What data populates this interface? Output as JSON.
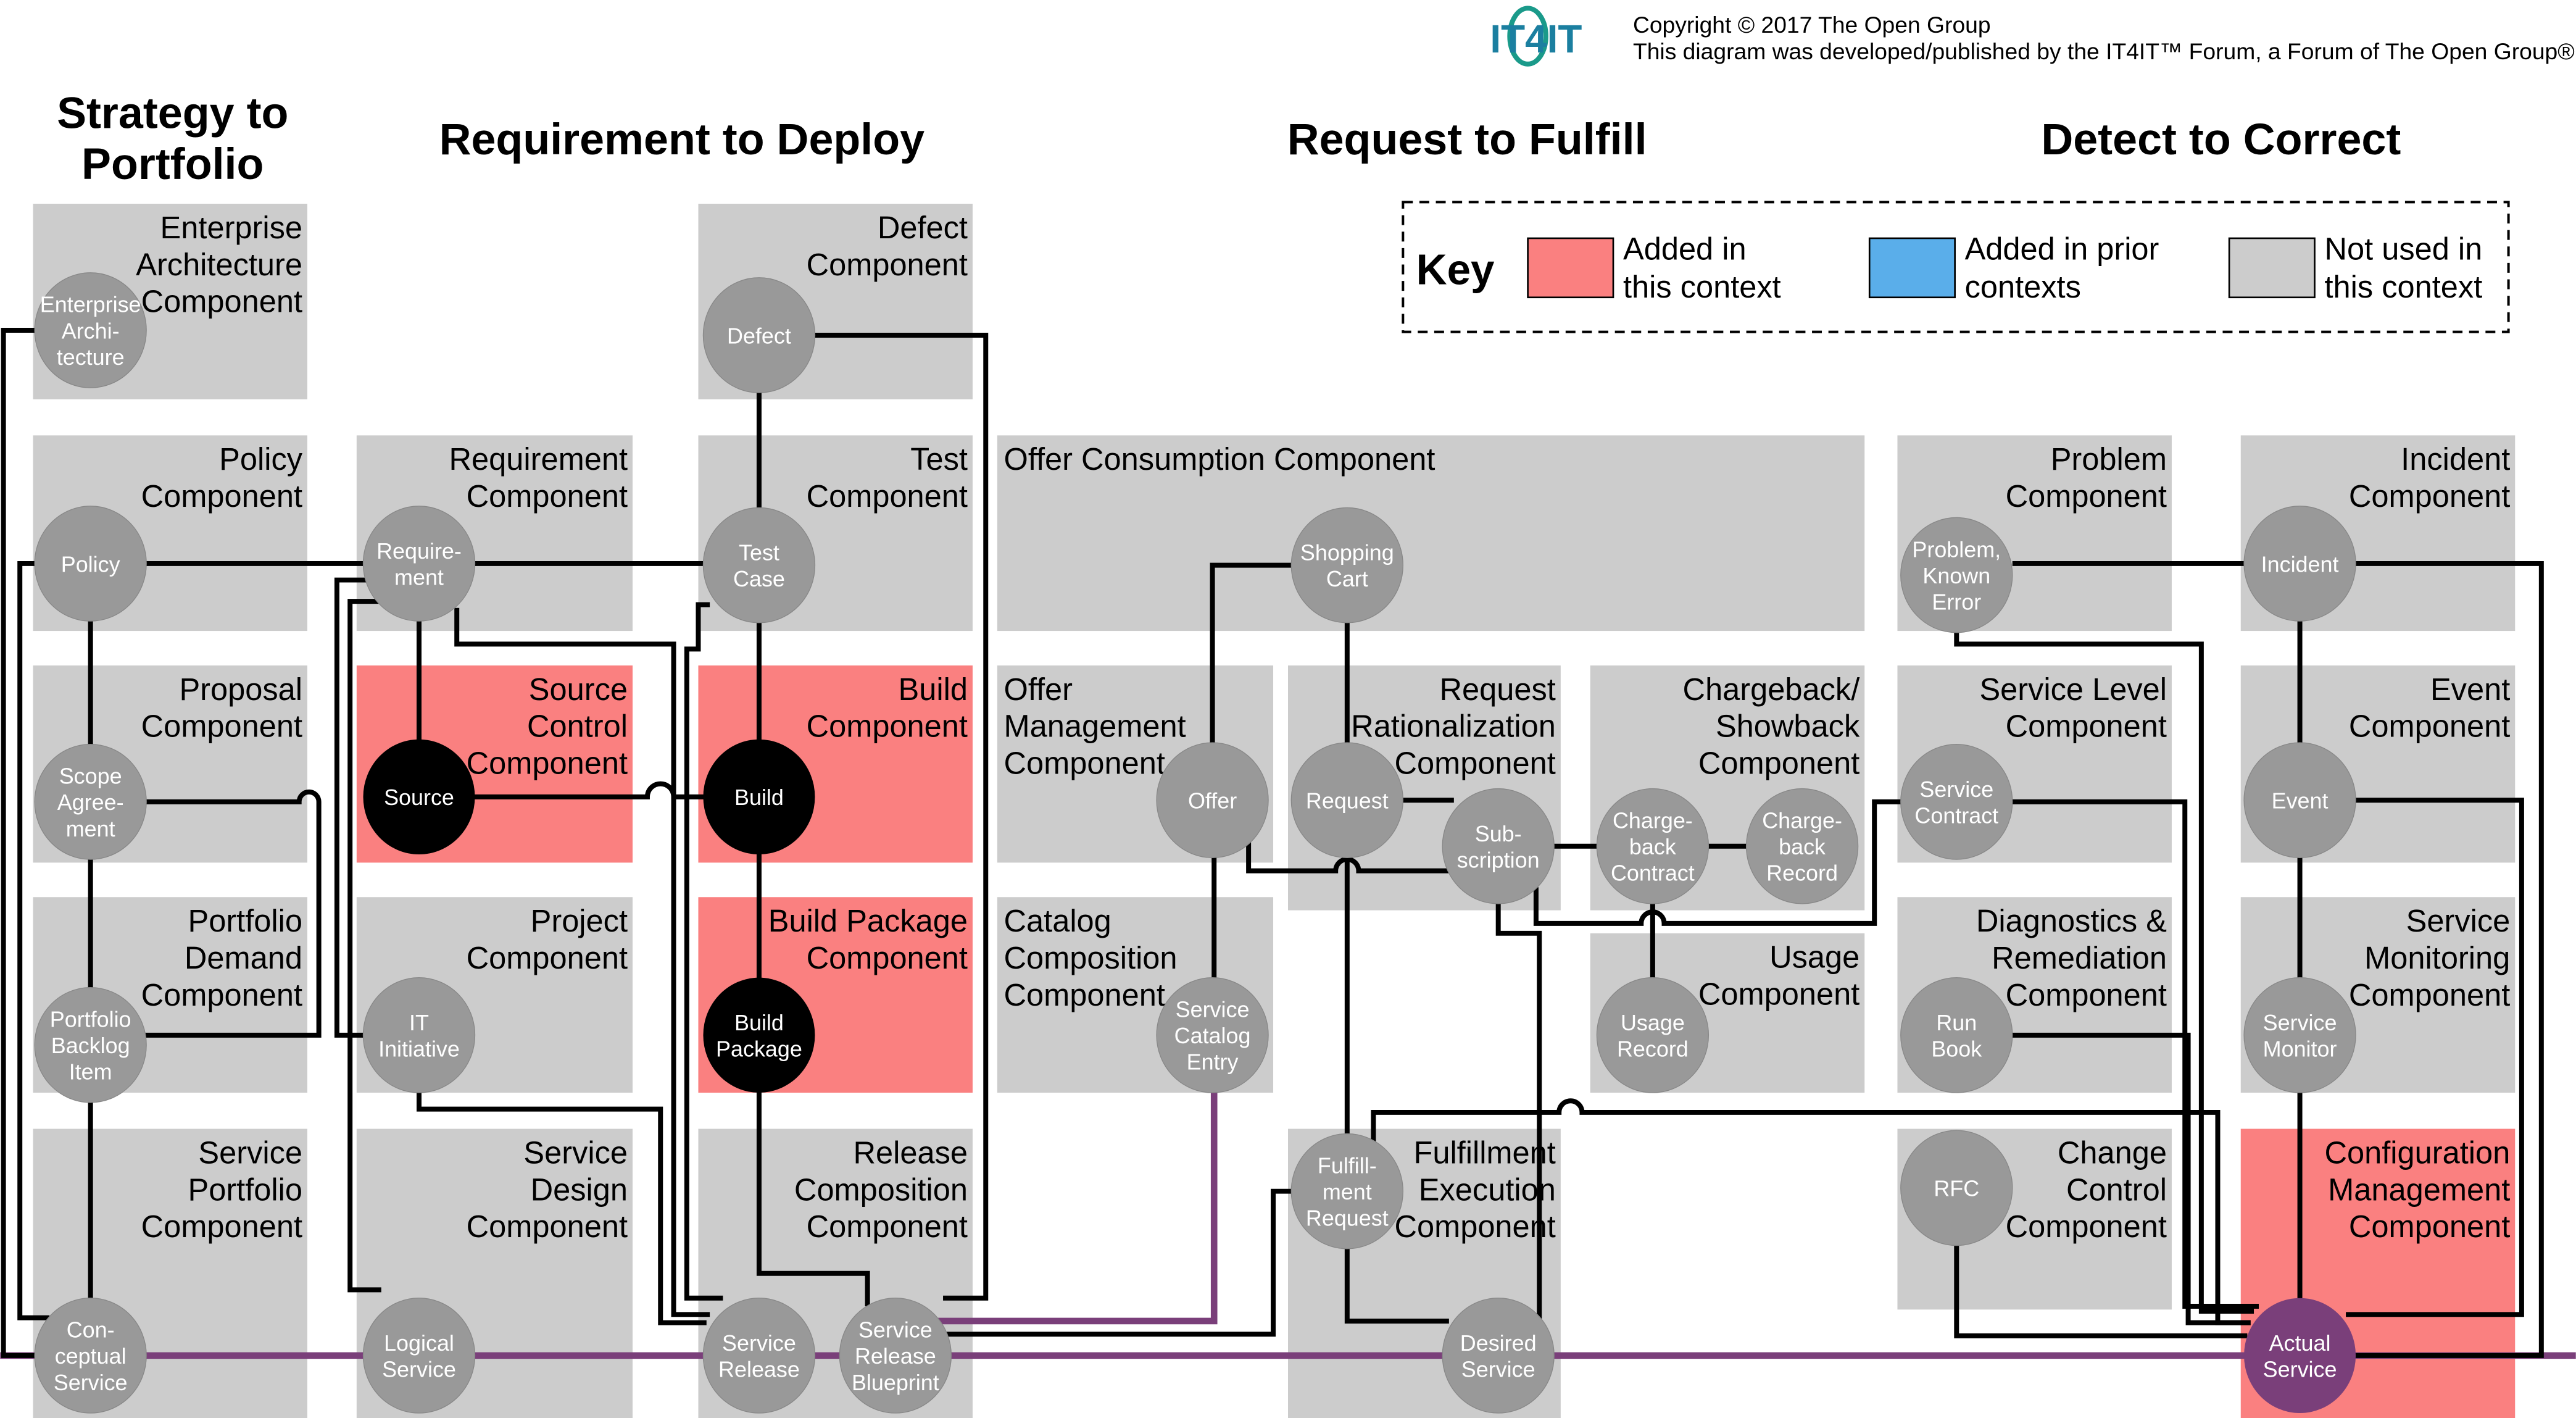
{
  "header": {
    "logo_text": "IT4IT",
    "copyright": "Copyright © 2017 The Open Group",
    "credit": "This diagram was developed/published by the IT4IT™ Forum, a Forum of The Open Group®"
  },
  "streams": [
    {
      "id": "s2p",
      "lines": [
        "Strategy to",
        "Portfolio"
      ]
    },
    {
      "id": "r2d",
      "lines": [
        "Requirement to Deploy"
      ]
    },
    {
      "id": "r2f",
      "lines": [
        "Request to Fulfill"
      ]
    },
    {
      "id": "d2c",
      "lines": [
        "Detect to Correct"
      ]
    }
  ],
  "key": {
    "title": "Key",
    "items": [
      {
        "color": "#fa8080",
        "lines": [
          "Added in",
          "this context"
        ]
      },
      {
        "color": "#5aaeea",
        "lines": [
          "Added in prior",
          "contexts"
        ]
      },
      {
        "color": "#cccccc",
        "lines": [
          "Not used in",
          "this context"
        ]
      }
    ]
  },
  "colors": {
    "unused": "#cccccc",
    "added": "#fa8080",
    "prior": "#5aaeea",
    "node": "#999999",
    "node_active": "#000000",
    "service_line": "#7a3f7a",
    "actual_service": "#7a3f7a"
  },
  "components": [
    {
      "id": "ea",
      "lines": [
        "Enterprise",
        "Architecture",
        "Component"
      ],
      "status": "unused"
    },
    {
      "id": "policy",
      "lines": [
        "Policy",
        "Component"
      ],
      "status": "unused"
    },
    {
      "id": "proposal",
      "lines": [
        "Proposal",
        "Component"
      ],
      "status": "unused"
    },
    {
      "id": "portfolio-demand",
      "lines": [
        "Portfolio",
        "Demand",
        "Component"
      ],
      "status": "unused"
    },
    {
      "id": "service-portfolio",
      "lines": [
        "Service",
        "Portfolio",
        "Component"
      ],
      "status": "unused"
    },
    {
      "id": "requirement",
      "lines": [
        "Requirement",
        "Component"
      ],
      "status": "unused"
    },
    {
      "id": "source-control",
      "lines": [
        "Source",
        "Control",
        "Component"
      ],
      "status": "added"
    },
    {
      "id": "project",
      "lines": [
        "Project",
        "Component"
      ],
      "status": "unused"
    },
    {
      "id": "service-design",
      "lines": [
        "Service",
        "Design",
        "Component"
      ],
      "status": "unused"
    },
    {
      "id": "defect",
      "lines": [
        "Defect",
        "Component"
      ],
      "status": "unused"
    },
    {
      "id": "test",
      "lines": [
        "Test",
        "Component"
      ],
      "status": "unused"
    },
    {
      "id": "build",
      "lines": [
        "Build",
        "Component"
      ],
      "status": "added"
    },
    {
      "id": "build-package",
      "lines": [
        "Build Package",
        "Component"
      ],
      "status": "added"
    },
    {
      "id": "release-composition",
      "lines": [
        "Release",
        "Composition",
        "Component"
      ],
      "status": "unused"
    },
    {
      "id": "offer-consumption",
      "lines": [
        "Offer Consumption Component"
      ],
      "status": "unused",
      "align": "left"
    },
    {
      "id": "offer-management",
      "lines": [
        "Offer",
        "Management",
        "Component"
      ],
      "status": "unused",
      "align": "left"
    },
    {
      "id": "catalog-composition",
      "lines": [
        "Catalog",
        "Composition",
        "Component"
      ],
      "status": "unused",
      "align": "left"
    },
    {
      "id": "request-rationalization",
      "lines": [
        "Request",
        "Rationalization",
        "Component"
      ],
      "status": "unused"
    },
    {
      "id": "chargeback",
      "lines": [
        "Chargeback/",
        "Showback",
        "Component"
      ],
      "status": "unused"
    },
    {
      "id": "usage",
      "lines": [
        "Usage",
        "Component"
      ],
      "status": "unused"
    },
    {
      "id": "fulfillment-execution",
      "lines": [
        "Fulfillment",
        "Execution",
        "Component"
      ],
      "status": "unused"
    },
    {
      "id": "problem",
      "lines": [
        "Problem",
        "Component"
      ],
      "status": "unused"
    },
    {
      "id": "service-level",
      "lines": [
        "Service Level",
        "Component"
      ],
      "status": "unused"
    },
    {
      "id": "diagnostics",
      "lines": [
        "Diagnostics &",
        "Remediation",
        "Component"
      ],
      "status": "unused"
    },
    {
      "id": "change-control",
      "lines": [
        "Change",
        "Control",
        "Component"
      ],
      "status": "unused"
    },
    {
      "id": "incident",
      "lines": [
        "Incident",
        "Component"
      ],
      "status": "unused"
    },
    {
      "id": "event",
      "lines": [
        "Event",
        "Component"
      ],
      "status": "unused"
    },
    {
      "id": "service-monitoring",
      "lines": [
        "Service",
        "Monitoring",
        "Component"
      ],
      "status": "unused"
    },
    {
      "id": "config-mgmt",
      "lines": [
        "Configuration",
        "Management",
        "Component"
      ],
      "status": "added"
    }
  ],
  "data_objects": [
    {
      "id": "enterprise-architecture",
      "lines": [
        "Enterprise",
        "Archi-",
        "tecture"
      ],
      "style": "gray"
    },
    {
      "id": "policy",
      "lines": [
        "Policy"
      ],
      "style": "gray"
    },
    {
      "id": "scope-agreement",
      "lines": [
        "Scope",
        "Agree-",
        "ment"
      ],
      "style": "gray"
    },
    {
      "id": "portfolio-backlog-item",
      "lines": [
        "Portfolio",
        "Backlog",
        "Item"
      ],
      "style": "gray"
    },
    {
      "id": "conceptual-service",
      "lines": [
        "Con-",
        "ceptual",
        "Service"
      ],
      "style": "gray"
    },
    {
      "id": "requirement",
      "lines": [
        "Require-",
        "ment"
      ],
      "style": "gray"
    },
    {
      "id": "source",
      "lines": [
        "Source"
      ],
      "style": "black"
    },
    {
      "id": "it-initiative",
      "lines": [
        "IT",
        "Initiative"
      ],
      "style": "gray"
    },
    {
      "id": "logical-service",
      "lines": [
        "Logical",
        "Service"
      ],
      "style": "gray"
    },
    {
      "id": "defect",
      "lines": [
        "Defect"
      ],
      "style": "gray"
    },
    {
      "id": "test-case",
      "lines": [
        "Test",
        "Case"
      ],
      "style": "gray"
    },
    {
      "id": "build",
      "lines": [
        "Build"
      ],
      "style": "black"
    },
    {
      "id": "build-package",
      "lines": [
        "Build",
        "Package"
      ],
      "style": "black"
    },
    {
      "id": "service-release",
      "lines": [
        "Service",
        "Release"
      ],
      "style": "gray"
    },
    {
      "id": "service-release-blueprint",
      "lines": [
        "Service",
        "Release",
        "Blueprint"
      ],
      "style": "gray"
    },
    {
      "id": "shopping-cart",
      "lines": [
        "Shopping",
        "Cart"
      ],
      "style": "gray"
    },
    {
      "id": "offer",
      "lines": [
        "Offer"
      ],
      "style": "gray"
    },
    {
      "id": "service-catalog-entry",
      "lines": [
        "Service",
        "Catalog",
        "Entry"
      ],
      "style": "gray"
    },
    {
      "id": "request",
      "lines": [
        "Request"
      ],
      "style": "gray"
    },
    {
      "id": "subscription",
      "lines": [
        "Sub-",
        "scription"
      ],
      "style": "gray"
    },
    {
      "id": "chargeback-contract",
      "lines": [
        "Charge-",
        "back",
        "Contract"
      ],
      "style": "gray"
    },
    {
      "id": "chargeback-record",
      "lines": [
        "Charge-",
        "back",
        "Record"
      ],
      "style": "gray"
    },
    {
      "id": "usage-record",
      "lines": [
        "Usage",
        "Record"
      ],
      "style": "gray"
    },
    {
      "id": "fulfillment-request",
      "lines": [
        "Fulfill-",
        "ment",
        "Request"
      ],
      "style": "gray"
    },
    {
      "id": "desired-service",
      "lines": [
        "Desired",
        "Service"
      ],
      "style": "gray"
    },
    {
      "id": "problem-known-error",
      "lines": [
        "Problem,",
        "Known",
        "Error"
      ],
      "style": "gray"
    },
    {
      "id": "service-contract",
      "lines": [
        "Service",
        "Contract"
      ],
      "style": "gray"
    },
    {
      "id": "run-book",
      "lines": [
        "Run",
        "Book"
      ],
      "style": "gray"
    },
    {
      "id": "rfc",
      "lines": [
        "RFC"
      ],
      "style": "gray"
    },
    {
      "id": "incident",
      "lines": [
        "Incident"
      ],
      "style": "gray"
    },
    {
      "id": "event",
      "lines": [
        "Event"
      ],
      "style": "gray"
    },
    {
      "id": "service-monitor",
      "lines": [
        "Service",
        "Monitor"
      ],
      "style": "gray"
    },
    {
      "id": "actual-service",
      "lines": [
        "Actual",
        "Service"
      ],
      "style": "purple"
    }
  ]
}
